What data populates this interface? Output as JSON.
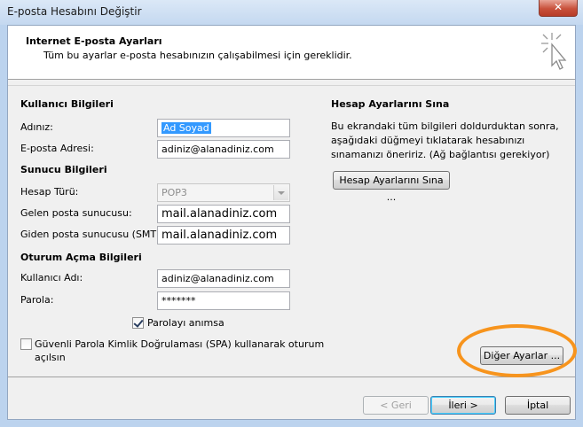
{
  "window": {
    "title": "E-posta Hesabını Değiştir",
    "close_glyph": "✕"
  },
  "header": {
    "title": "Internet E-posta Ayarları",
    "subtitle": "Tüm bu ayarlar e-posta hesabınızın çalışabilmesi için gereklidir.",
    "icon": "cursor-sparkle-icon"
  },
  "user_info": {
    "heading": "Kullanıcı Bilgileri",
    "name_label": "Adınız:",
    "name_value": "Ad Soyad",
    "email_label": "E-posta Adresi:",
    "email_value": "adiniz@alanadiniz.com"
  },
  "server_info": {
    "heading": "Sunucu Bilgileri",
    "account_type_label": "Hesap Türü:",
    "account_type_value": "POP3",
    "incoming_label": "Gelen posta sunucusu:",
    "incoming_value": "mail.alanadiniz.com",
    "outgoing_label": "Giden posta sunucusu (SMTP):",
    "outgoing_value": "mail.alanadiniz.com"
  },
  "logon_info": {
    "heading": "Oturum Açma Bilgileri",
    "username_label": "Kullanıcı Adı:",
    "username_value": "adiniz@alanadiniz.com",
    "password_label": "Parola:",
    "password_value": "*******",
    "remember_label": "Parolayı anımsa",
    "remember_checked": true,
    "spa_label_line1": "Güvenli Parola Kimlik Doğrulaması (SPA) kullanarak oturum",
    "spa_label_line2": "açılsın",
    "spa_checked": false
  },
  "test_settings": {
    "heading": "Hesap Ayarlarını Sına",
    "description": "Bu ekrandaki tüm bilgileri doldurduktan sonra, aşağıdaki düğmeyi tıklatarak hesabınızı sınamanızı öneririz. (Ağ bağlantısı gerekiyor)",
    "test_button": "Hesap Ayarlarını Sına ...",
    "more_settings_button": "Diğer Ayarlar ..."
  },
  "footer": {
    "back_button": "< Geri",
    "next_button": "İleri >",
    "cancel_button": "İptal"
  },
  "colors": {
    "highlight": "#f7941d",
    "selection": "#3399ff"
  }
}
